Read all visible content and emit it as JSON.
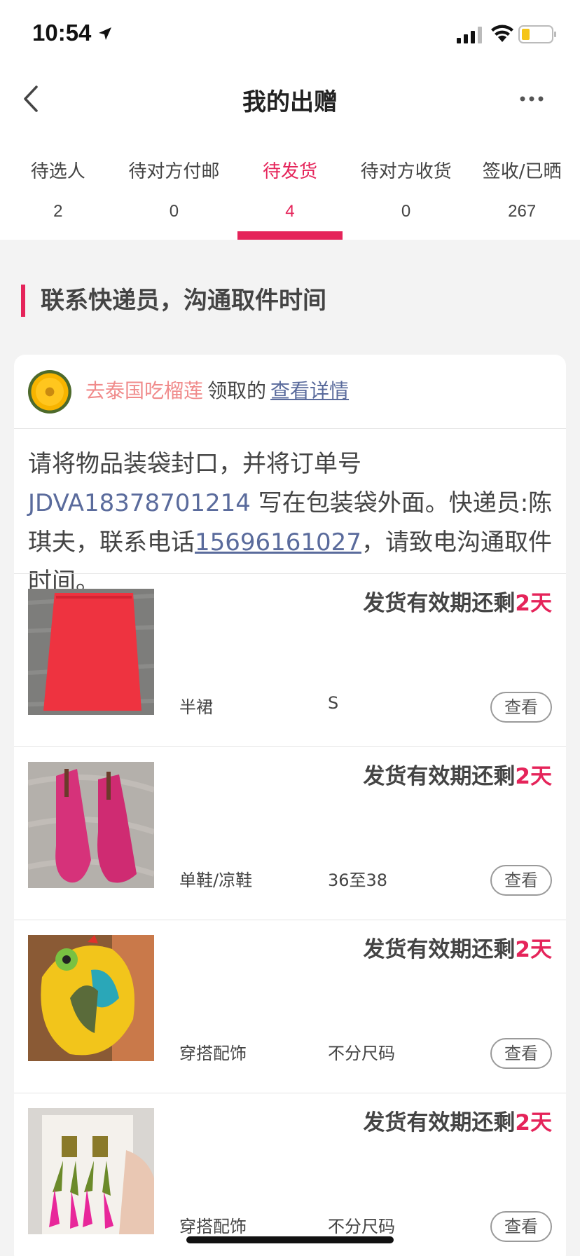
{
  "status_bar": {
    "time": "10:54"
  },
  "nav": {
    "title": "我的出赠"
  },
  "tabs": [
    {
      "label": "待选人",
      "count": "2"
    },
    {
      "label": "待对方付邮",
      "count": "0"
    },
    {
      "label": "待发货",
      "count": "4",
      "active": true
    },
    {
      "label": "待对方收货",
      "count": "0"
    },
    {
      "label": "签收/已晒",
      "count": "267"
    }
  ],
  "section": {
    "heading": "联系快递员，沟通取件时间"
  },
  "claimer": {
    "name": "去泰国吃榴莲",
    "action": "领取的",
    "link": "查看详情"
  },
  "instructions": {
    "part1": "请将物品装袋封口，并将订单号 ",
    "order_no": "JDVA18378701214",
    "part2": " 写在包装袋外面。快递员:陈琪夫，联系电话",
    "phone": "15696161027",
    "part3": "，请致电沟通取件时间。"
  },
  "items": [
    {
      "deadline_prefix": "发货有效期还剩",
      "deadline_days": "2天",
      "category": "半裙",
      "size": "S",
      "button": "查看"
    },
    {
      "deadline_prefix": "发货有效期还剩",
      "deadline_days": "2天",
      "category": "单鞋/凉鞋",
      "size": "36至38",
      "button": "查看"
    },
    {
      "deadline_prefix": "发货有效期还剩",
      "deadline_days": "2天",
      "category": "穿搭配饰",
      "size": "不分尺码",
      "button": "查看"
    },
    {
      "deadline_prefix": "发货有效期还剩",
      "deadline_days": "2天",
      "category": "穿搭配饰",
      "size": "不分尺码",
      "button": "查看"
    }
  ],
  "colors": {
    "accent": "#e5245a",
    "link": "#5a6b9c",
    "claimer_name": "#f08b8b"
  }
}
